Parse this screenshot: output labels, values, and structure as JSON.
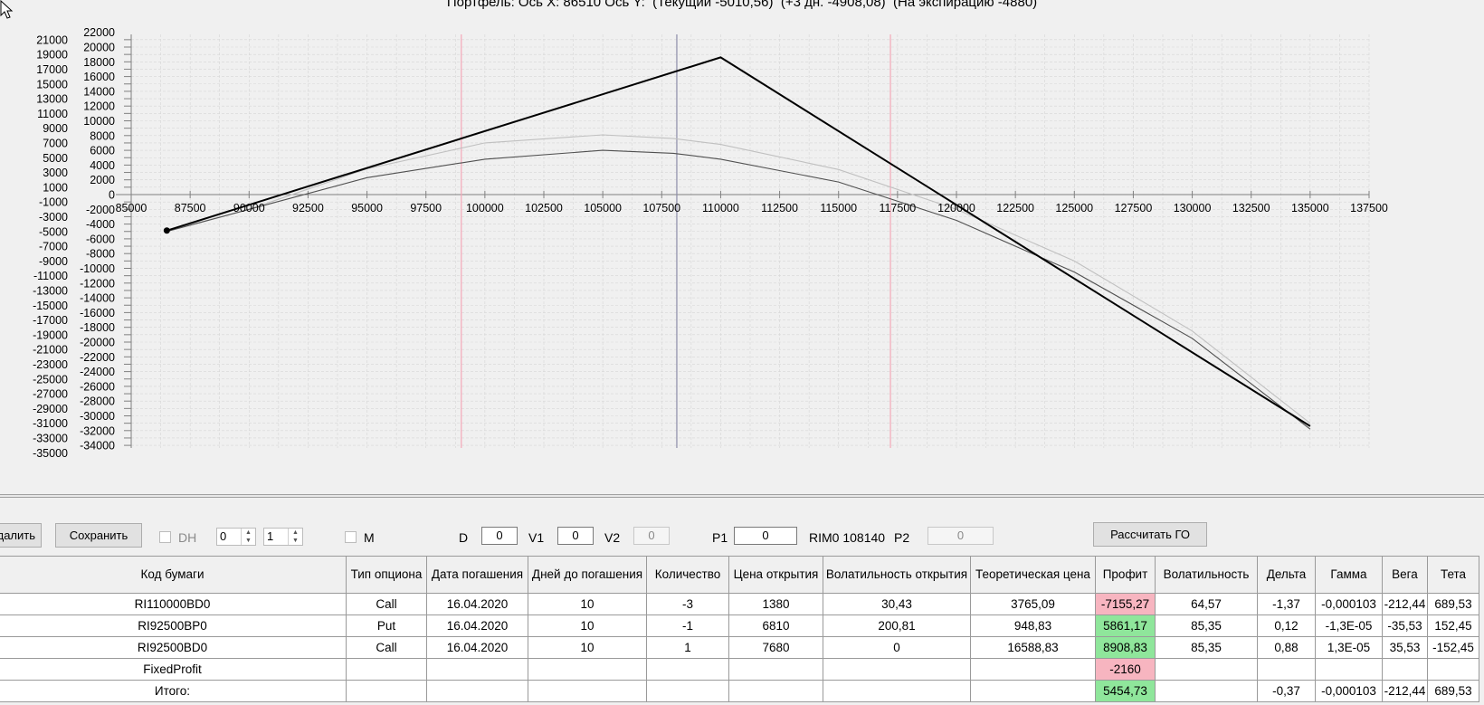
{
  "chart": {
    "title": "Портфель: Ось X: 86510 Ось Y:  (Текущий -5010,56)  (+3 дн. -4908,08)  (На экспирацию -4880)"
  },
  "chart_data": {
    "type": "line",
    "title": "Портфель: Ось X: 86510 Ось Y:  (Текущий -5010,56)  (+3 дн. -4908,08)  (На экспирацию -4880)",
    "xlim": [
      85000,
      137500
    ],
    "y_outer_ticks": [
      21000,
      19000,
      17000,
      15000,
      13000,
      11000,
      9000,
      7000,
      5000,
      3000,
      1000,
      -1000,
      -3000,
      -5000,
      -7000,
      -9000,
      -11000,
      -13000,
      -15000,
      -17000,
      -19000,
      -21000,
      -23000,
      -25000,
      -27000,
      -29000,
      -31000,
      -33000,
      -35000
    ],
    "y_inner_ticks": [
      22000,
      20000,
      18000,
      16000,
      14000,
      12000,
      10000,
      8000,
      6000,
      4000,
      2000,
      0,
      -2000,
      -4000,
      -6000,
      -8000,
      -10000,
      -12000,
      -14000,
      -16000,
      -18000,
      -20000,
      -22000,
      -24000,
      -26000,
      -28000,
      -30000,
      -32000,
      -34000
    ],
    "x_tick_labels": [
      "85000",
      "87500",
      "90000",
      "92500",
      "95000",
      "97500",
      "100000",
      "102500",
      "105000",
      "107500",
      "110000",
      "112500",
      "115000",
      "117500",
      "120000",
      "122500",
      "125000",
      "127500",
      "130000",
      "132500",
      "135000",
      "137500"
    ],
    "x_ticks": [
      85000,
      87500,
      90000,
      92500,
      95000,
      97500,
      100000,
      102500,
      105000,
      107500,
      110000,
      112500,
      115000,
      117500,
      120000,
      122500,
      125000,
      127500,
      130000,
      132500,
      135000,
      137500
    ],
    "vertical_lines": [
      {
        "x": 99000,
        "color": "#f4a8b8"
      },
      {
        "x": 108140,
        "color": "#8c8ca8"
      },
      {
        "x": 117200,
        "color": "#f4a8b8"
      }
    ],
    "marker": {
      "x": 86510,
      "y": -4880
    },
    "series": [
      {
        "color": "#000000",
        "points": [
          [
            86510,
            -4880
          ],
          [
            110000,
            18600
          ],
          [
            135000,
            -31400
          ]
        ]
      },
      {
        "color": "#505050",
        "points": [
          [
            86510,
            -5010
          ],
          [
            90000,
            -2000
          ],
          [
            95000,
            2300
          ],
          [
            100000,
            4800
          ],
          [
            105000,
            6000
          ],
          [
            108000,
            5600
          ],
          [
            110000,
            4800
          ],
          [
            115000,
            1700
          ],
          [
            120000,
            -3500
          ],
          [
            125000,
            -10500
          ],
          [
            130000,
            -19500
          ],
          [
            135000,
            -31800
          ]
        ]
      },
      {
        "color": "#c0c0c0",
        "points": [
          [
            86510,
            -4910
          ],
          [
            90000,
            -2000
          ],
          [
            95000,
            3500
          ],
          [
            100000,
            7000
          ],
          [
            105000,
            8100
          ],
          [
            108000,
            7600
          ],
          [
            110000,
            6800
          ],
          [
            115000,
            3400
          ],
          [
            120000,
            -2000
          ],
          [
            125000,
            -9000
          ],
          [
            130000,
            -18500
          ],
          [
            135000,
            -31000
          ]
        ]
      }
    ],
    "grid": true,
    "colors": {
      "bg": "#f0f0f0",
      "grid": "#d6d6d6",
      "axis": "#808080"
    }
  },
  "toolbar": {
    "delete_label": "Удалить",
    "save_label": "Сохранить",
    "dh_label": "DH",
    "spin1": "0",
    "spin2": "1",
    "m_label": "M",
    "d_label": "D",
    "d_value": "0",
    "v1_label": "V1",
    "v1_value": "0",
    "v2_label": "V2",
    "v2_value": "0",
    "p1_label": "P1",
    "p1_value": "0",
    "rim_label": "RIM0 108140",
    "p2_label": "P2",
    "p2_value": "0",
    "calc_label": "Рассчитать ГО"
  },
  "table": {
    "headers": [
      "Код бумаги",
      "Тип опциона",
      "Дата погашения",
      "Дней до погашения",
      "Количество",
      "Цена открытия",
      "Волатильность открытия",
      "Теоретическая цена",
      "Профит",
      "Волатильность",
      "Дельта",
      "Гамма",
      "Вега",
      "Тета"
    ],
    "rows": [
      {
        "cells": [
          "RI110000BD0",
          "Call",
          "16.04.2020",
          "10",
          "-3",
          "1380",
          "30,43",
          "3765,09",
          "-7155,27",
          "64,57",
          "-1,37",
          "-0,000103",
          "-212,44",
          "689,53"
        ],
        "profit": "red"
      },
      {
        "cells": [
          "RI92500BP0",
          "Put",
          "16.04.2020",
          "10",
          "-1",
          "6810",
          "200,81",
          "948,83",
          "5861,17",
          "85,35",
          "0,12",
          "-1,3E-05",
          "-35,53",
          "152,45"
        ],
        "profit": "green"
      },
      {
        "cells": [
          "RI92500BD0",
          "Call",
          "16.04.2020",
          "10",
          "1",
          "7680",
          "0",
          "16588,83",
          "8908,83",
          "85,35",
          "0,88",
          "1,3E-05",
          "35,53",
          "-152,45"
        ],
        "profit": "green"
      },
      {
        "cells": [
          "FixedProfit",
          "",
          "",
          "",
          "",
          "",
          "",
          "",
          "-2160",
          "",
          "",
          "",
          "",
          ""
        ],
        "profit": "red"
      },
      {
        "cells": [
          "Итого:",
          "",
          "",
          "",
          "",
          "",
          "",
          "",
          "5454,73",
          "",
          "-0,37",
          "-0,000103",
          "-212,44",
          "689,53"
        ],
        "profit": "green"
      }
    ],
    "profit_colors": {
      "red": "#f7b5c0",
      "green": "#8fe69b"
    }
  }
}
